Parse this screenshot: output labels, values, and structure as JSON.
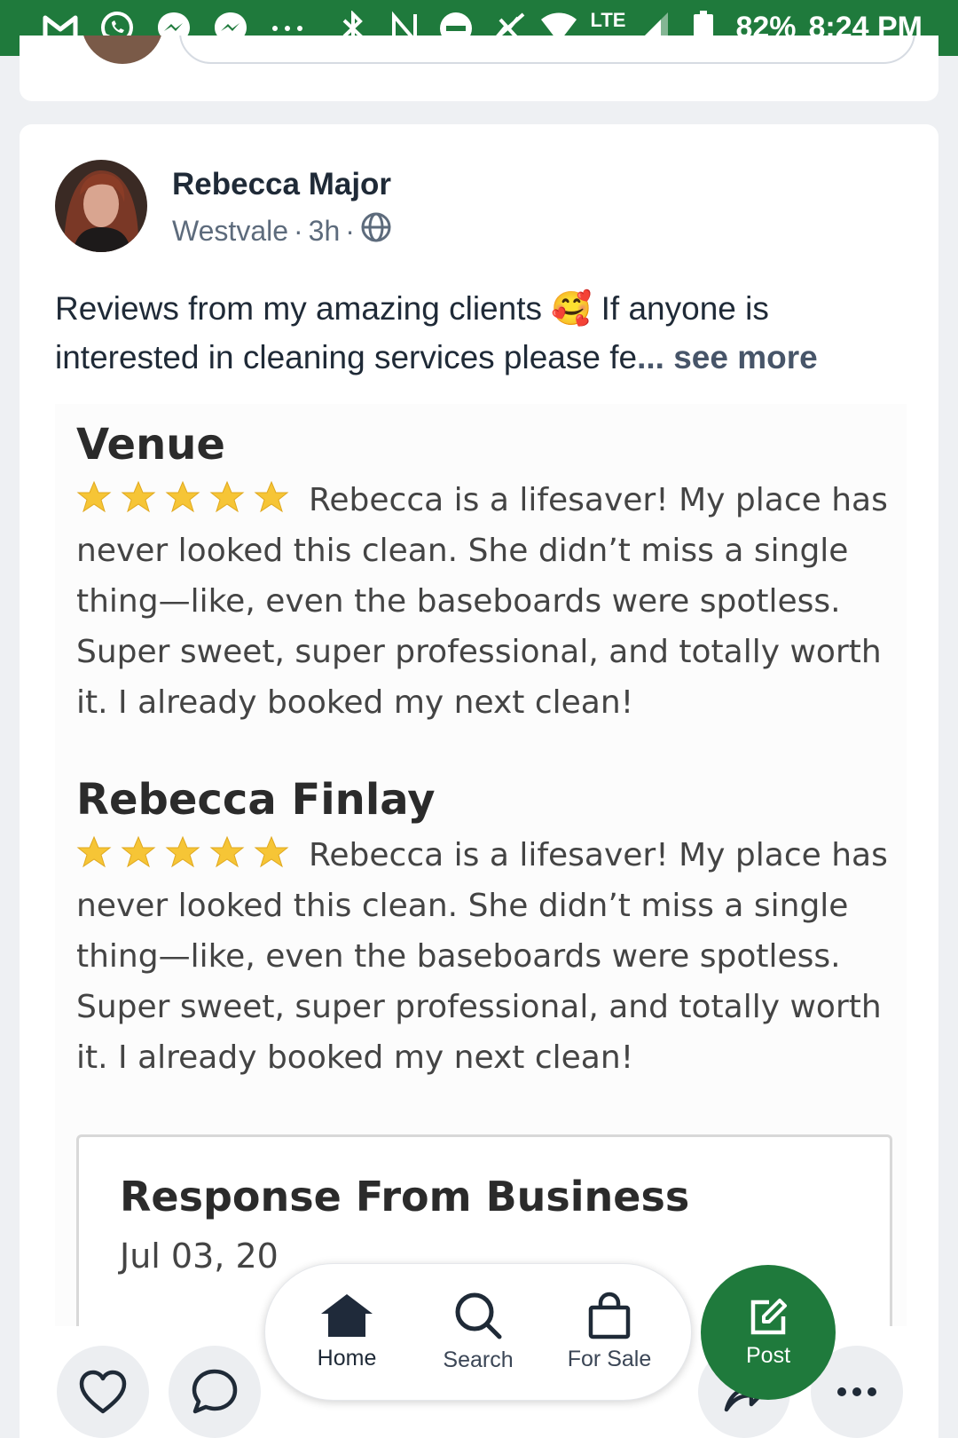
{
  "status_bar": {
    "left_icons": [
      "gmail-icon",
      "whatsapp-icon",
      "messenger-icon",
      "messenger-icon",
      "more-dots-icon"
    ],
    "network": "LTE",
    "battery": "82%",
    "time": "8:24 PM"
  },
  "post": {
    "author": "Rebecca Major",
    "location": "Westvale",
    "age": "3h",
    "separator": "·",
    "text_part1": "Reviews from my amazing clients",
    "emoji": "🥰",
    "text_part2": " If anyone is interested in cleaning services please fe",
    "see_more": "... see more"
  },
  "reviews": [
    {
      "name": "Venue",
      "stars": 5,
      "body": "Rebecca is a lifesaver! My place has never looked this clean. She didn’t miss a single thing—like, even the baseboards were spotless. Super sweet, super professional, and totally worth it. I already booked my next clean!"
    },
    {
      "name": "Rebecca Finlay",
      "stars": 5,
      "body": "Rebecca is a lifesaver! My place has never looked this clean. She didn’t miss a single thing—like, even the baseboards were spotless. Super sweet, super professional, and totally worth it. I already booked my next clean!"
    }
  ],
  "response": {
    "title": "Response From Business",
    "date": "Jul 03, 20"
  },
  "nav": {
    "home": "Home",
    "search": "Search",
    "for_sale": "For Sale",
    "post": "Post"
  },
  "colors": {
    "brand_green": "#1f7a3c",
    "star_yellow": "#f6c536"
  }
}
